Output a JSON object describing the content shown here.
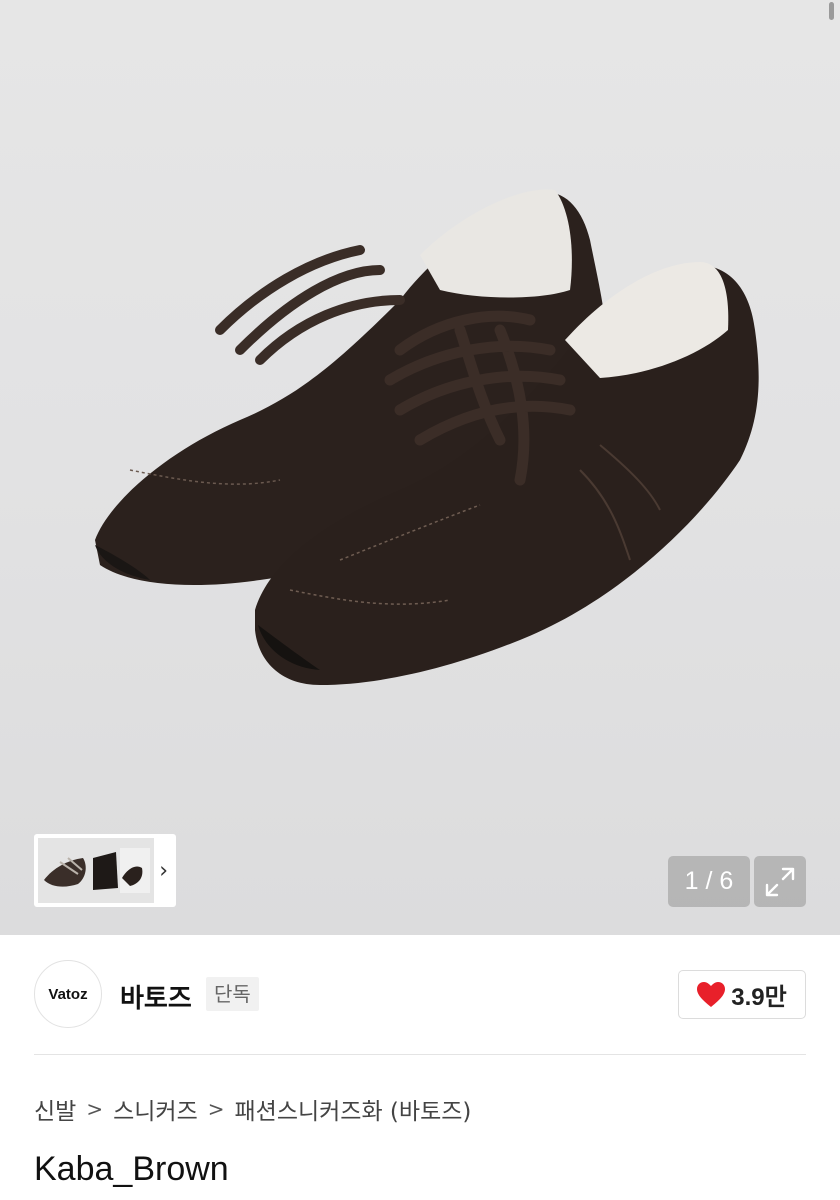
{
  "gallery": {
    "counter": "1 / 6",
    "thumbnail_next": "›"
  },
  "brand": {
    "logo_text": "Vatoz",
    "name": "바토즈",
    "badge": "단독",
    "likes": "3.9만"
  },
  "breadcrumb": {
    "items": [
      "신발",
      "스니커즈",
      "패션스니커즈화 (바토즈)"
    ],
    "separator": ">"
  },
  "product": {
    "title": "Kaba_Brown"
  },
  "icons": {
    "expand": "expand-icon",
    "heart": "heart-icon",
    "next": "chevron-right-icon"
  },
  "colors": {
    "heart": "#e8202a",
    "shoe": "#2a201c"
  }
}
